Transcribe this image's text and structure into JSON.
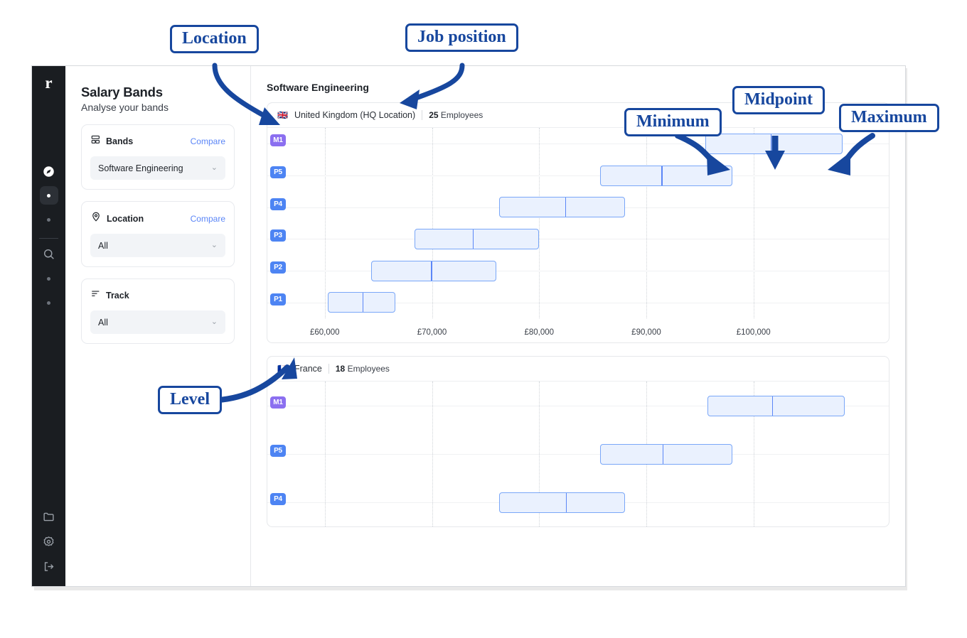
{
  "rail": {
    "logo": "r",
    "items": [
      {
        "name": "compass-icon"
      },
      {
        "name": "active-dot-icon"
      },
      {
        "name": "dot-icon"
      },
      {
        "name": "search-icon"
      },
      {
        "name": "dot-icon"
      },
      {
        "name": "dot-icon"
      }
    ],
    "bottom": [
      {
        "name": "folder-icon"
      },
      {
        "name": "gear-icon"
      },
      {
        "name": "logout-icon"
      }
    ]
  },
  "panel": {
    "title": "Salary Bands",
    "subtitle": "Analyse your bands",
    "cards": [
      {
        "icon": "bands-icon",
        "label": "Bands",
        "action": "Compare",
        "value": "Software Engineering",
        "chevron": "⌄"
      },
      {
        "icon": "location-pin-icon",
        "label": "Location",
        "action": "Compare",
        "value": "All",
        "chevron": "⌄"
      },
      {
        "icon": "track-icon",
        "label": "Track",
        "action": "",
        "value": "All",
        "chevron": "⌄"
      }
    ]
  },
  "main": {
    "title": "Software Engineering"
  },
  "colors": {
    "accent": "#5b86f7",
    "level_blue": "#4d84f3",
    "level_purple": "#8b6ff0",
    "bar_fill": "#eaf1fe",
    "bar_stroke": "#7aa7f8",
    "annotation": "#17479e",
    "rail_bg": "#1a1d21"
  },
  "annotations": [
    {
      "id": "location",
      "label": "Location"
    },
    {
      "id": "job-position",
      "label": "Job position"
    },
    {
      "id": "minimum",
      "label": "Minimum"
    },
    {
      "id": "midpoint",
      "label": "Midpoint"
    },
    {
      "id": "maximum",
      "label": "Maximum"
    },
    {
      "id": "level",
      "label": "Level"
    }
  ],
  "chart_data": [
    {
      "type": "bar",
      "title": "United Kingdom (HQ Location)",
      "flag": "🇬🇧",
      "employees_count": "25",
      "employees_label": "Employees",
      "xlabel": "",
      "ylabel": "",
      "xlim": [
        56500,
        110500
      ],
      "xticks": [
        60000,
        70000,
        80000,
        90000,
        100000
      ],
      "xtick_labels": [
        "£60,000",
        "£70,000",
        "£80,000",
        "£90,000",
        "£100,000"
      ],
      "grid": true,
      "legend": "none",
      "categories": [
        "M1",
        "P5",
        "P4",
        "P3",
        "P2",
        "P1"
      ],
      "bands": [
        {
          "level": "M1",
          "min": 95500,
          "mid": 101600,
          "max": 108300,
          "color": "#8b6ff0"
        },
        {
          "level": "P5",
          "min": 85700,
          "mid": 91400,
          "max": 98000,
          "color": "#4d84f3"
        },
        {
          "level": "P4",
          "min": 76300,
          "mid": 82400,
          "max": 88000,
          "color": "#4d84f3"
        },
        {
          "level": "P3",
          "min": 68400,
          "mid": 73800,
          "max": 80000,
          "color": "#4d84f3"
        },
        {
          "level": "P2",
          "min": 64300,
          "mid": 69900,
          "max": 76000,
          "color": "#4d84f3"
        },
        {
          "level": "P1",
          "min": 60300,
          "mid": 63500,
          "max": 66600,
          "color": "#4d84f3"
        }
      ]
    },
    {
      "type": "bar",
      "title": "France",
      "flag": "🇫🇷",
      "employees_count": "18",
      "employees_label": "Employees",
      "xlabel": "",
      "ylabel": "",
      "xlim": [
        56500,
        110500
      ],
      "xticks": [
        60000,
        70000,
        80000,
        90000,
        100000
      ],
      "xtick_labels": [
        "£60,000",
        "£70,000",
        "£80,000",
        "£90,000",
        "£100,000"
      ],
      "grid": true,
      "legend": "none",
      "categories": [
        "M1",
        "P5",
        "P4"
      ],
      "bands": [
        {
          "level": "M1",
          "min": 95700,
          "mid": 101700,
          "max": 108500,
          "color": "#8b6ff0"
        },
        {
          "level": "P5",
          "min": 85700,
          "mid": 91500,
          "max": 98000,
          "color": "#4d84f3"
        },
        {
          "level": "P4",
          "min": 76300,
          "mid": 82500,
          "max": 88000,
          "color": "#4d84f3"
        }
      ]
    }
  ]
}
